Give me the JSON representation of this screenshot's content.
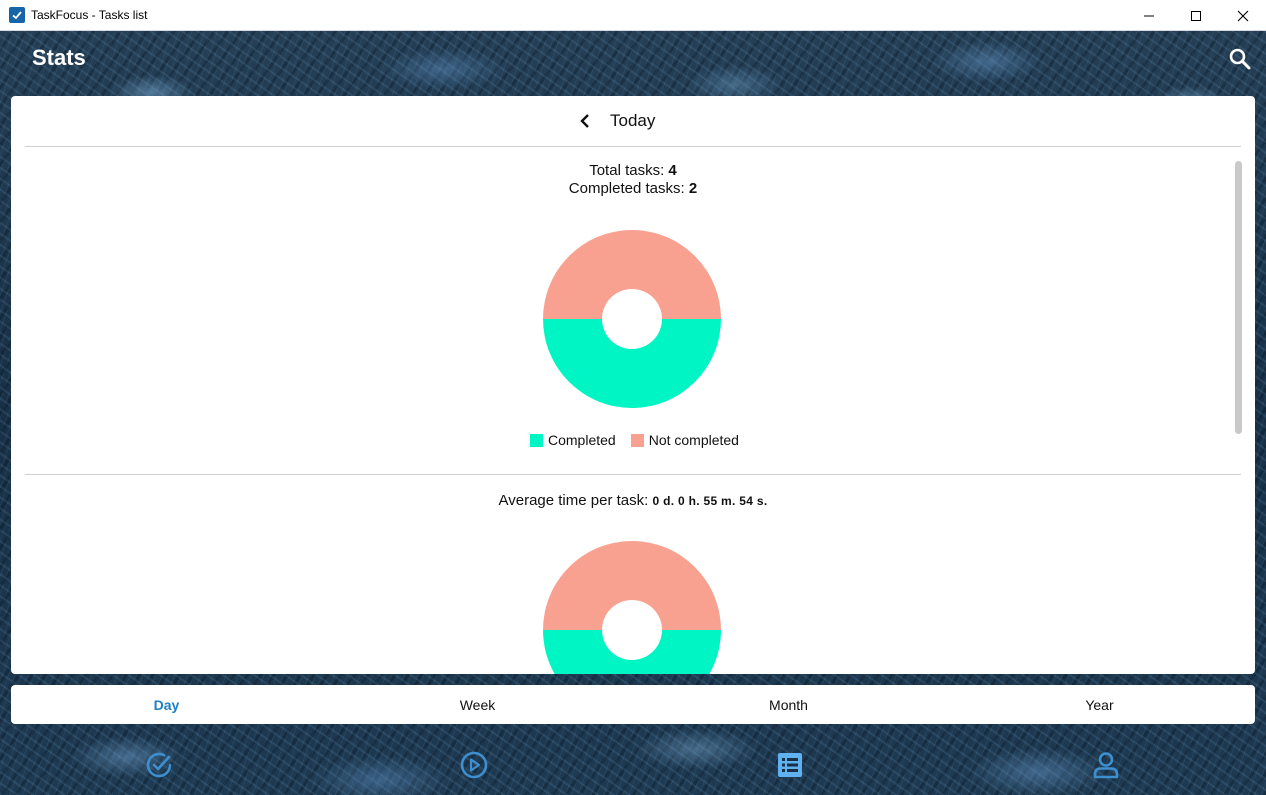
{
  "window": {
    "title": "TaskFocus - Tasks list"
  },
  "header": {
    "title": "Stats",
    "search_icon": "search-icon"
  },
  "period": {
    "label": "Today",
    "back_icon": "chevron-left-icon"
  },
  "tasks_stats": {
    "total_label": "Total tasks: ",
    "total_value": "4",
    "completed_label": "Completed tasks: ",
    "completed_value": "2"
  },
  "legend": {
    "completed": "Completed",
    "not_completed": "Not completed"
  },
  "avg_time": {
    "label": "Average time per task: ",
    "value": "0 d. 0 h. 55 m. 54 s."
  },
  "colors": {
    "completed": "#00f5c4",
    "not_completed": "#f9a191",
    "accent": "#1e7fc3"
  },
  "chart_data": [
    {
      "type": "pie",
      "categories": [
        "Completed",
        "Not completed"
      ],
      "values": [
        2,
        2
      ],
      "colors": [
        "#00f5c4",
        "#f9a191"
      ],
      "legend": "bottom"
    },
    {
      "type": "pie",
      "categories": [
        "Completed",
        "Not completed"
      ],
      "colors": [
        "#00f5c4",
        "#f9a191"
      ],
      "note_visible": "partially visible, cut off by scroll"
    }
  ],
  "tabs": [
    {
      "label": "Day",
      "active": true
    },
    {
      "label": "Week",
      "active": false
    },
    {
      "label": "Month",
      "active": false
    },
    {
      "label": "Year",
      "active": false
    }
  ],
  "bottom_nav": [
    {
      "icon": "check-circle-icon",
      "active": false
    },
    {
      "icon": "play-circle-icon",
      "active": false
    },
    {
      "icon": "list-icon",
      "active": true
    },
    {
      "icon": "person-icon",
      "active": false
    }
  ]
}
